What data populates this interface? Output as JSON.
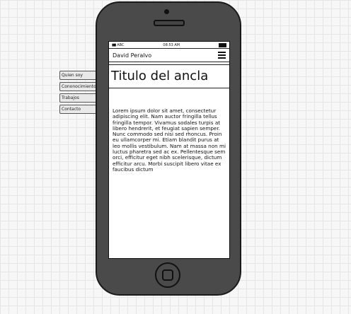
{
  "side_menu": {
    "items": [
      {
        "label": "Quien soy"
      },
      {
        "label": "Cononocimientos"
      },
      {
        "label": "Trabajos"
      },
      {
        "label": "Contacto"
      }
    ]
  },
  "status_bar": {
    "carrier": "ABC",
    "time": "08:53 AM"
  },
  "navbar": {
    "brand": "David Peralvo",
    "menu_icon": "hamburger-menu-icon"
  },
  "content": {
    "title": "Titulo del ancla",
    "body": "Lorem ipsum dolor sit amet, consectetur adipiscing elit. Nam auctor fringilla tellus fringilla tempor. Vivamus sodales turpis at libero hendrerit, et feugiat sapien semper. Nunc commodo sed nisi sed rhoncus. Proin eu ullamcorper mi. Etiam blandit purus at leo mollis vestibulum. Nam at massa non mi luctus pharetra sed ac ex. Pellentesque sem orci, efficitur eget nibh scelerisque, dictum efficitur arcu. Morbi suscipit libero vitae ex faucibus dictum"
  },
  "colors": {
    "phone_body": "#4a4a4a",
    "screen": "#ffffff",
    "grid": "#e6e6e6"
  }
}
